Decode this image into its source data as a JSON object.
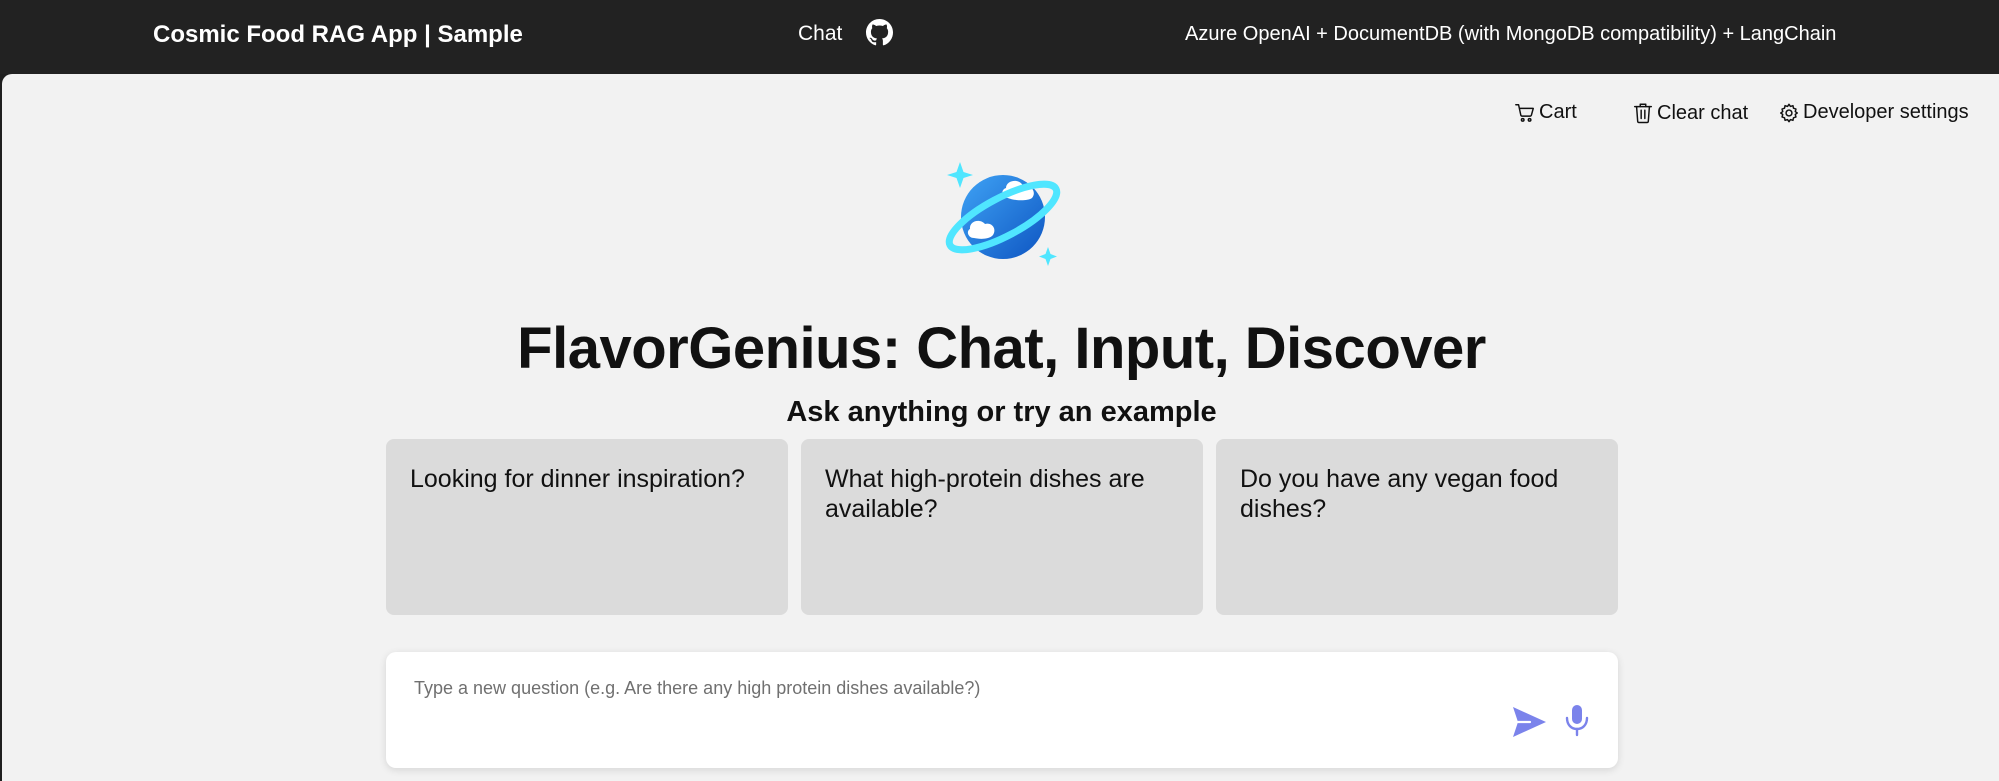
{
  "header": {
    "brand": "Cosmic Food RAG App | Sample",
    "nav_chat": "Chat",
    "github_icon": "github-icon",
    "tagline": "Azure OpenAI + DocumentDB (with MongoDB compatibility) + LangChain"
  },
  "commands": {
    "cart": {
      "label": "Cart",
      "icon": "cart-icon"
    },
    "clear_chat": {
      "label": "Clear chat",
      "icon": "trash-icon"
    },
    "developer_settings": {
      "label": "Developer settings",
      "icon": "gear-icon"
    }
  },
  "main": {
    "logo_icon": "cosmos-planet-icon",
    "title": "FlavorGenius: Chat, Input, Discover",
    "subtitle": "Ask anything or try an example",
    "examples": [
      "Looking for dinner inspiration?",
      "What high-protein dishes are available?",
      "Do you have any vegan food dishes?"
    ]
  },
  "composer": {
    "placeholder": "Type a new question (e.g. Are there any high protein dishes available?)",
    "value": "",
    "send_icon": "send-icon",
    "mic_icon": "microphone-icon"
  },
  "colors": {
    "header_bg": "#222222",
    "panel_bg": "#f2f2f2",
    "example_bg": "#dbdbdb",
    "accent": "#7b83eb",
    "logo_blue": "#1d6fd8",
    "logo_cyan": "#50e6ff"
  }
}
